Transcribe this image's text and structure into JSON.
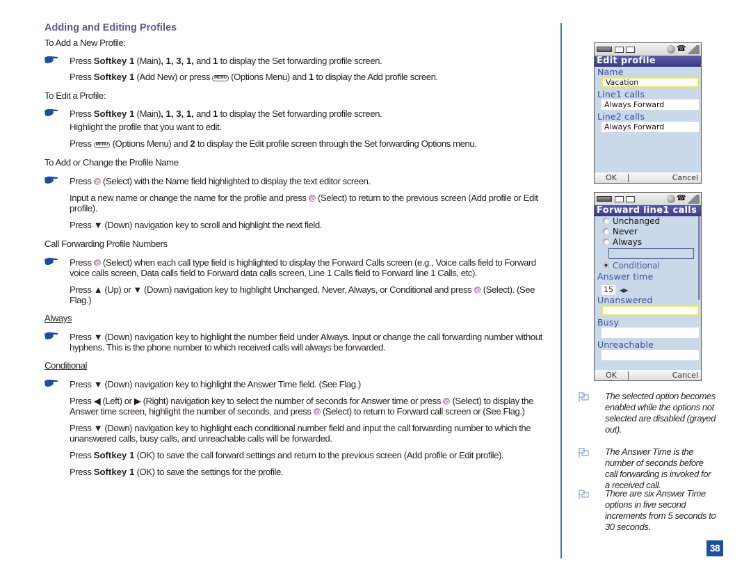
{
  "heading": "Adding and Editing Profiles",
  "sections": {
    "add_new": {
      "title": "To Add a New Profile:",
      "step1": {
        "a": "Press ",
        "b1": "Softkey 1",
        "c": " (Main)",
        "b2": ", 1, 3, 1,",
        "d": " and ",
        "b3": "1",
        "e": " to display the Set forwarding profile screen."
      },
      "step2": {
        "a": "Press ",
        "b1": "Softkey 1",
        "c": " (Add New) or press ",
        "key": "MENU",
        "d": " (Options Menu) and ",
        "b2": "1",
        "e": " to display the Add profile screen."
      }
    },
    "edit": {
      "title": "To Edit a Profile:",
      "step1": {
        "a": "Press ",
        "b1": "Softkey 1",
        "c": " (Main)",
        "b2": ", 1, 3, 1,",
        "d": " and ",
        "b3": "1",
        "e": " to display the Set forwarding profile screen."
      },
      "step2": "Highlight the profile that you want to edit.",
      "step3": {
        "a": "Press ",
        "key": "MENU",
        "b": " (Options Menu) and ",
        "b1": "2",
        "c": " to display the Edit profile screen through the Set forwarding Options menu."
      }
    },
    "name": {
      "title": "To Add or Change the Profile Name",
      "step1": {
        "a": "Press ",
        "b": " (Select) with the Name field highlighted to display the text editor screen."
      },
      "step2": {
        "a": "Input a new name or change the name for the profile and press ",
        "b": " (Select) to return to the previous screen (Add profile or Edit profile)."
      },
      "step3": {
        "a": "Press ",
        "tri": "▼",
        "b": " (Down) navigation key to scroll and highlight the next field."
      }
    },
    "numbers": {
      "title": "Call Forwarding Profile Numbers",
      "step1": {
        "a": "Press ",
        "b": " (Select) when each call type field is highlighted to display the Forward Calls screen (e.g., Voice calls field to Forward voice calls screen, Data calls field to Forward data calls screen, Line 1 Calls field to Forward line 1 Calls, etc)."
      },
      "step2": {
        "a": "Press ",
        "up": "▲",
        "b": " (Up) or ",
        "down": "▼",
        "c": " (Down) navigation key to highlight Unchanged, Never, Always, or Conditional and press ",
        "d": " (Select). (See Flag.)"
      }
    },
    "always": {
      "title": "Always",
      "step1": {
        "a": "Press ",
        "tri": "▼",
        "b": " (Down) navigation key to highlight the number field under Always. Input or change the call forwarding number without hyphens. This is the phone number to which received calls will always be forwarded."
      }
    },
    "conditional": {
      "title": "Conditional",
      "step1": {
        "a": "Press ",
        "tri": "▼",
        "b": " (Down) navigation key to highlight the Answer Time field. (See Flag.)"
      },
      "step2": {
        "a": "Press ",
        "left": "◀",
        "b": " (Left) or ",
        "right": "▶",
        "c": " (Right) navigation key to select the number of seconds for Answer time or press ",
        "d": " (Select) to display the Answer time screen, highlight the number of seconds, and press ",
        "e": " (Select) to return to Forward call screen or (See Flag.)"
      },
      "step3": {
        "a": "Press ",
        "tri": "▼",
        "b": " (Down) navigation key to highlight each conditional number field and input the call forwarding number to which the unanswered calls, busy calls, and unreachable calls will be forwarded."
      },
      "step4": {
        "a": "Press ",
        "b1": "Softkey 1",
        "c": " (OK) to save the call forward settings and return to the previous screen (Add profile or Edit profile)."
      },
      "step5": {
        "a": "Press ",
        "b1": "Softkey 1",
        "c": " (OK) to save the settings for the profile."
      }
    }
  },
  "screen_edit_profile": {
    "title": "Edit profile",
    "name_label": "Name",
    "name_value": "Vacation",
    "line1_label": "Line1 calls",
    "line1_value": "Always Forward",
    "line2_label": "Line2 calls",
    "line2_value": "Always Forward",
    "softkey_left": "OK",
    "softkey_right": "Cancel"
  },
  "screen_forward_line1": {
    "title": "Forward line1 calls",
    "options": [
      "Unchanged",
      "Never",
      "Always",
      "Conditional"
    ],
    "selected_option": "Conditional",
    "answer_time_label": "Answer time",
    "answer_time_value": "15",
    "unanswered_label": "Unanswered",
    "busy_label": "Busy",
    "unreachable_label": "Unreachable",
    "softkey_left": "OK",
    "softkey_right": "Cancel"
  },
  "flags": [
    "The selected option becomes enabled while the options not selected are disabled (grayed out).",
    "The Answer Time is the number of seconds before call forwarding is invoked for a received call.",
    "There are six Answer Time options in five second increments from 5 seconds to 30 seconds."
  ],
  "page_number": "38",
  "colors": {
    "accent": "#1f4e9c",
    "heading": "#5b5b8a",
    "divider": "#3e73b8",
    "phone_title": "#3a3a86"
  }
}
